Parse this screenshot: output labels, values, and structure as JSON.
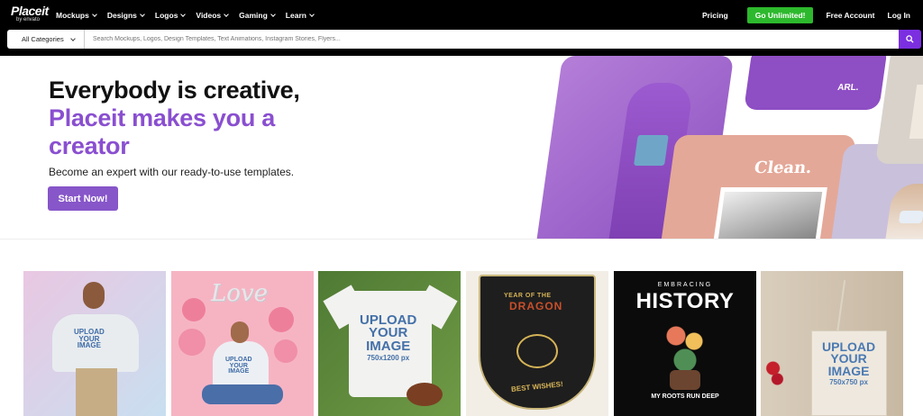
{
  "header": {
    "logo_main": "Placeit",
    "logo_sub": "by envato",
    "nav": [
      "Mockups",
      "Designs",
      "Logos",
      "Videos",
      "Gaming",
      "Learn"
    ],
    "pricing": "Pricing",
    "go_unlimited": "Go Unlimited!",
    "free_account": "Free Account",
    "login": "Log In"
  },
  "search": {
    "category": "All Categories",
    "placeholder": "Search Mockups, Logos, Design Templates, Text Animations, Instagram Stories, Flyers..."
  },
  "hero": {
    "line1": "Everybody is creative,",
    "line2": "Placeit makes you a",
    "line3": "creator",
    "subtitle": "Become an expert with our ready-to-use templates.",
    "cta": "Start Now!"
  },
  "collage": {
    "clean": "Clean."
  },
  "cards": {
    "c1": {
      "t1": "UPLOAD",
      "t2": "YOUR",
      "t3": "IMAGE"
    },
    "c2": {
      "balloon": "Love",
      "t1": "UPLOAD",
      "t2": "YOUR",
      "t3": "IMAGE"
    },
    "c3": {
      "t1": "UPLOAD",
      "t2": "YOUR",
      "t3": "IMAGE",
      "t4": "750x1200 px"
    },
    "c4": {
      "t1": "YEAR OF THE",
      "t2": "DRAGON",
      "t3": "BEST WISHES!"
    },
    "c5": {
      "t1": "EMBRACING",
      "t2": "HISTORY",
      "t3": "MY ROOTS RUN DEEP"
    },
    "c6": {
      "t1": "UPLOAD",
      "t2": "YOUR",
      "t3": "IMAGE",
      "t4": "750x750 px"
    }
  },
  "colors": {
    "accent": "#8a4fd0",
    "search_btn": "#7b2fe0",
    "go_btn": "#2db92d"
  }
}
